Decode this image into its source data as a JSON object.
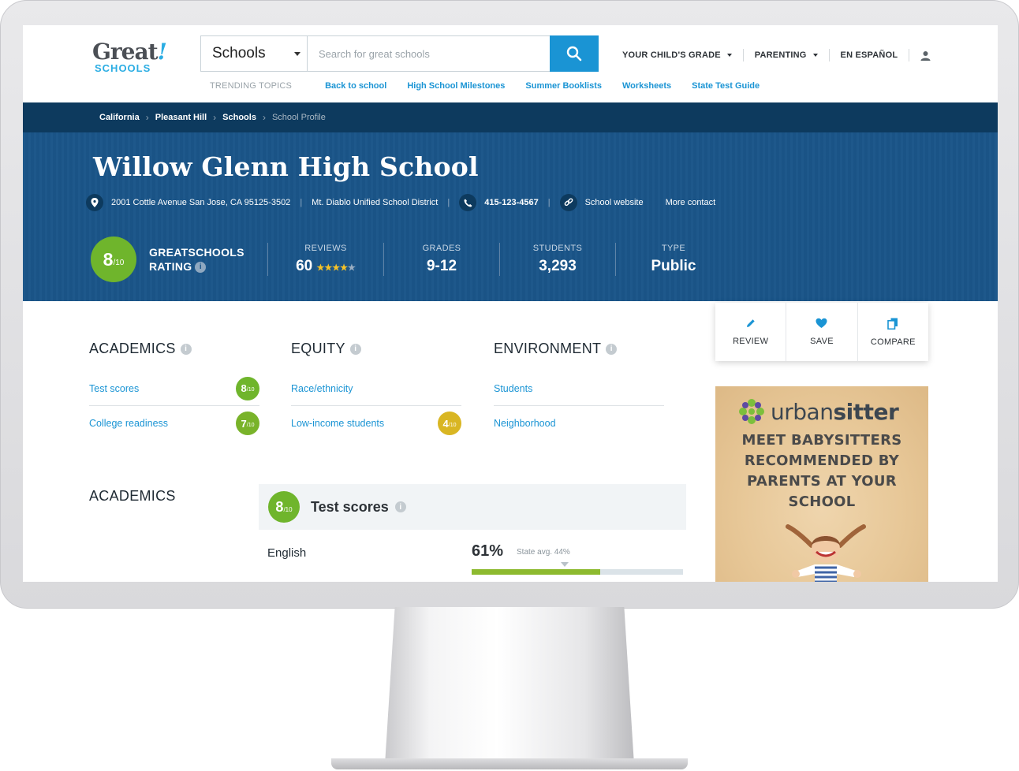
{
  "colors": {
    "accent": "#1a94d4",
    "hero": "#1a5589",
    "breadcrumb": "#0d3a5e",
    "rating_green": "#6fb52c",
    "rating_yellow": "#d9b623"
  },
  "logo": {
    "great": "Great",
    "excl": "!",
    "schools": "SCHOOLS"
  },
  "search": {
    "category": "Schools",
    "placeholder": "Search for great schools",
    "icon": "search-icon"
  },
  "topnav": {
    "grade": "YOUR CHILD'S GRADE",
    "parenting": "PARENTING",
    "spanish": "EN ESPAÑOL",
    "account_icon": "user-icon"
  },
  "trending": {
    "label": "TRENDING TOPICS",
    "links": [
      "Back to school",
      "High School Milestones",
      "Summer Booklists",
      "Worksheets",
      "State Test Guide"
    ]
  },
  "breadcrumb": {
    "items": [
      "California",
      "Pleasant Hill",
      "Schools"
    ],
    "current": "School Profile"
  },
  "school": {
    "name": "Willow Glenn High School",
    "address": "2001 Cottle Avenue San Jose, CA 95125-3502",
    "district": "Mt. Diablo Unified School District",
    "phone": "415-123-4567",
    "website": "School website",
    "more_contact": "More contact"
  },
  "stats": {
    "rating": "8",
    "rating_denom": "/10",
    "rating_label_1": "GREATSCHOOLS",
    "rating_label_2": "RATING",
    "reviews_label": "REVIEWS",
    "reviews_value": "60",
    "reviews_stars": 4,
    "grades_label": "GRADES",
    "grades_value": "9-12",
    "students_label": "STUDENTS",
    "students_value": "3,293",
    "type_label": "TYPE",
    "type_value": "Public"
  },
  "actions": {
    "review": "REVIEW",
    "save": "SAVE",
    "compare": "COMPARE"
  },
  "categories": {
    "academics": {
      "title": "ACADEMICS",
      "rows": [
        {
          "label": "Test scores",
          "rating": "8"
        },
        {
          "label": "College readiness",
          "rating": "7"
        }
      ]
    },
    "equity": {
      "title": "EQUITY",
      "rows": [
        {
          "label": "Race/ethnicity",
          "rating": ""
        },
        {
          "label": "Low-income students",
          "rating": "4"
        }
      ]
    },
    "environment": {
      "title": "ENVIRONMENT",
      "rows": [
        {
          "label": "Students",
          "rating": ""
        },
        {
          "label": "Neighborhood",
          "rating": ""
        }
      ]
    }
  },
  "ad": {
    "brand_light": "urban",
    "brand_bold": "sitter",
    "line1": "MEET BABYSITTERS",
    "line2": "RECOMMENDED BY",
    "line3": "PARENTS AT YOUR",
    "line4": "SCHOOL"
  },
  "academics_section": {
    "title": "ACADEMICS",
    "test_scores": {
      "rating": "8",
      "denom": "/10",
      "title": "Test scores"
    },
    "english": {
      "label": "English",
      "pct": "61%",
      "state_avg": "State avg. 44%",
      "value": 61,
      "state_avg_value": 44
    }
  }
}
